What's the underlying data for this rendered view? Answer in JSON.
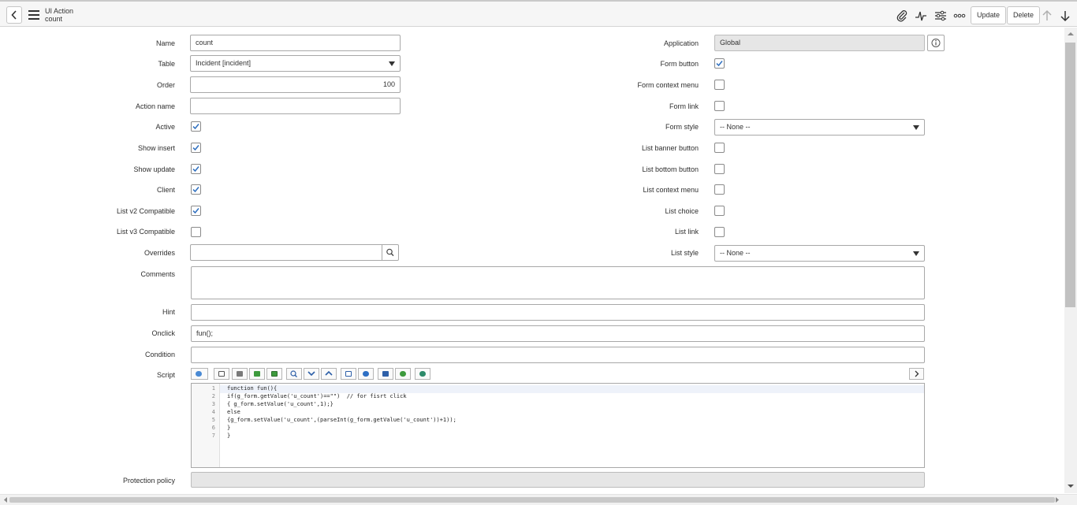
{
  "header": {
    "record_type": "UI Action",
    "record_name": "count",
    "buttons": {
      "update": "Update",
      "delete": "Delete"
    }
  },
  "form": {
    "left": {
      "name": {
        "label": "Name",
        "value": "count"
      },
      "table": {
        "label": "Table",
        "value": "Incident [incident]"
      },
      "order": {
        "label": "Order",
        "value": "100"
      },
      "action_name": {
        "label": "Action name",
        "value": ""
      },
      "active": {
        "label": "Active",
        "checked": true
      },
      "show_insert": {
        "label": "Show insert",
        "checked": true
      },
      "show_update": {
        "label": "Show update",
        "checked": true
      },
      "client": {
        "label": "Client",
        "checked": true
      },
      "list_v2": {
        "label": "List v2 Compatible",
        "checked": true
      },
      "list_v3": {
        "label": "List v3 Compatible",
        "checked": false
      },
      "overrides": {
        "label": "Overrides",
        "value": ""
      }
    },
    "right": {
      "application": {
        "label": "Application",
        "value": "Global"
      },
      "form_button": {
        "label": "Form button",
        "checked": true
      },
      "form_context_menu": {
        "label": "Form context menu",
        "checked": false
      },
      "form_link": {
        "label": "Form link",
        "checked": false
      },
      "form_style": {
        "label": "Form style",
        "value": "-- None --"
      },
      "list_banner_button": {
        "label": "List banner button",
        "checked": false
      },
      "list_bottom_button": {
        "label": "List bottom button",
        "checked": false
      },
      "list_context_menu": {
        "label": "List context menu",
        "checked": false
      },
      "list_choice": {
        "label": "List choice",
        "checked": false
      },
      "list_link": {
        "label": "List link",
        "checked": false
      },
      "list_style": {
        "label": "List style",
        "value": "-- None --"
      }
    },
    "wide": {
      "comments": {
        "label": "Comments",
        "value": ""
      },
      "hint": {
        "label": "Hint",
        "value": ""
      },
      "onclick": {
        "label": "Onclick",
        "value": "fun();"
      },
      "condition": {
        "label": "Condition",
        "value": ""
      },
      "script": {
        "label": "Script",
        "lines": [
          {
            "no": "1",
            "text": "function fun(){"
          },
          {
            "no": "2",
            "text": "if(g_form.getValue('u_count')==\"\")  // for fisrt click"
          },
          {
            "no": "3",
            "text": "{ g_form.setValue('u_count',1);}"
          },
          {
            "no": "4",
            "text": "else"
          },
          {
            "no": "5",
            "text": "{g_form.setValue('u_count',(parseInt(g_form.getValue('u_count'))+1));"
          },
          {
            "no": "6",
            "text": "}"
          },
          {
            "no": "7",
            "text": "}"
          }
        ]
      },
      "protection_policy": {
        "label": "Protection policy",
        "value": ""
      }
    }
  },
  "icons": {
    "back": "chevron-left-icon",
    "menu": "hamburger-icon",
    "attachment": "paperclip-icon",
    "activity": "activity-pulse-icon",
    "settings": "sliders-icon",
    "more": "ellipsis-icon",
    "prev": "arrow-up-icon",
    "next": "arrow-down-icon",
    "info": "info-icon",
    "search": "search-icon"
  },
  "colors": {
    "accent": "#2e6fbf",
    "check": "#2e6fbf",
    "readonly_bg": "#e6e6e6"
  }
}
